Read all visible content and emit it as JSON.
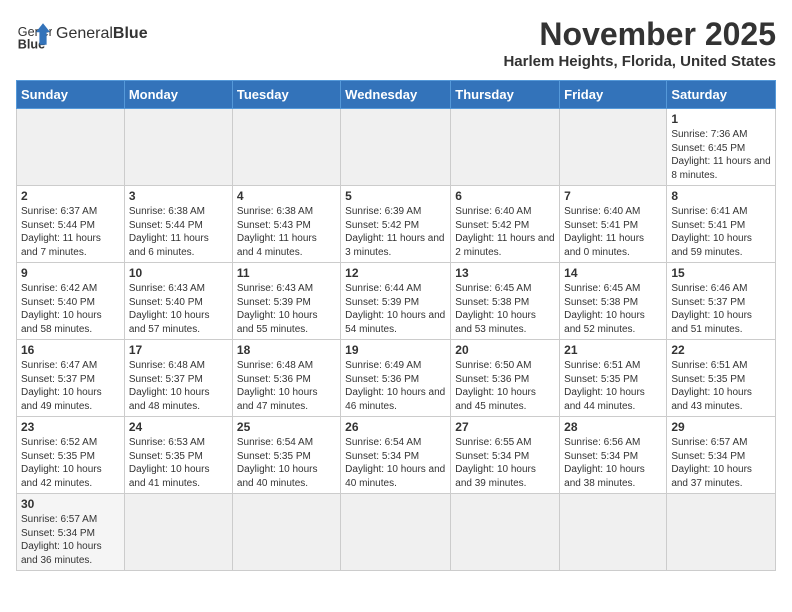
{
  "logo": {
    "text_normal": "General",
    "text_bold": "Blue"
  },
  "title": "November 2025",
  "location": "Harlem Heights, Florida, United States",
  "weekdays": [
    "Sunday",
    "Monday",
    "Tuesday",
    "Wednesday",
    "Thursday",
    "Friday",
    "Saturday"
  ],
  "weeks": [
    [
      {
        "day": "",
        "info": ""
      },
      {
        "day": "",
        "info": ""
      },
      {
        "day": "",
        "info": ""
      },
      {
        "day": "",
        "info": ""
      },
      {
        "day": "",
        "info": ""
      },
      {
        "day": "",
        "info": ""
      },
      {
        "day": "1",
        "info": "Sunrise: 7:36 AM\nSunset: 6:45 PM\nDaylight: 11 hours\nand 8 minutes."
      }
    ],
    [
      {
        "day": "2",
        "info": "Sunrise: 6:37 AM\nSunset: 5:44 PM\nDaylight: 11 hours\nand 7 minutes."
      },
      {
        "day": "3",
        "info": "Sunrise: 6:38 AM\nSunset: 5:44 PM\nDaylight: 11 hours\nand 6 minutes."
      },
      {
        "day": "4",
        "info": "Sunrise: 6:38 AM\nSunset: 5:43 PM\nDaylight: 11 hours\nand 4 minutes."
      },
      {
        "day": "5",
        "info": "Sunrise: 6:39 AM\nSunset: 5:42 PM\nDaylight: 11 hours\nand 3 minutes."
      },
      {
        "day": "6",
        "info": "Sunrise: 6:40 AM\nSunset: 5:42 PM\nDaylight: 11 hours\nand 2 minutes."
      },
      {
        "day": "7",
        "info": "Sunrise: 6:40 AM\nSunset: 5:41 PM\nDaylight: 11 hours\nand 0 minutes."
      },
      {
        "day": "8",
        "info": "Sunrise: 6:41 AM\nSunset: 5:41 PM\nDaylight: 10 hours\nand 59 minutes."
      }
    ],
    [
      {
        "day": "9",
        "info": "Sunrise: 6:42 AM\nSunset: 5:40 PM\nDaylight: 10 hours\nand 58 minutes."
      },
      {
        "day": "10",
        "info": "Sunrise: 6:43 AM\nSunset: 5:40 PM\nDaylight: 10 hours\nand 57 minutes."
      },
      {
        "day": "11",
        "info": "Sunrise: 6:43 AM\nSunset: 5:39 PM\nDaylight: 10 hours\nand 55 minutes."
      },
      {
        "day": "12",
        "info": "Sunrise: 6:44 AM\nSunset: 5:39 PM\nDaylight: 10 hours\nand 54 minutes."
      },
      {
        "day": "13",
        "info": "Sunrise: 6:45 AM\nSunset: 5:38 PM\nDaylight: 10 hours\nand 53 minutes."
      },
      {
        "day": "14",
        "info": "Sunrise: 6:45 AM\nSunset: 5:38 PM\nDaylight: 10 hours\nand 52 minutes."
      },
      {
        "day": "15",
        "info": "Sunrise: 6:46 AM\nSunset: 5:37 PM\nDaylight: 10 hours\nand 51 minutes."
      }
    ],
    [
      {
        "day": "16",
        "info": "Sunrise: 6:47 AM\nSunset: 5:37 PM\nDaylight: 10 hours\nand 49 minutes."
      },
      {
        "day": "17",
        "info": "Sunrise: 6:48 AM\nSunset: 5:37 PM\nDaylight: 10 hours\nand 48 minutes."
      },
      {
        "day": "18",
        "info": "Sunrise: 6:48 AM\nSunset: 5:36 PM\nDaylight: 10 hours\nand 47 minutes."
      },
      {
        "day": "19",
        "info": "Sunrise: 6:49 AM\nSunset: 5:36 PM\nDaylight: 10 hours\nand 46 minutes."
      },
      {
        "day": "20",
        "info": "Sunrise: 6:50 AM\nSunset: 5:36 PM\nDaylight: 10 hours\nand 45 minutes."
      },
      {
        "day": "21",
        "info": "Sunrise: 6:51 AM\nSunset: 5:35 PM\nDaylight: 10 hours\nand 44 minutes."
      },
      {
        "day": "22",
        "info": "Sunrise: 6:51 AM\nSunset: 5:35 PM\nDaylight: 10 hours\nand 43 minutes."
      }
    ],
    [
      {
        "day": "23",
        "info": "Sunrise: 6:52 AM\nSunset: 5:35 PM\nDaylight: 10 hours\nand 42 minutes."
      },
      {
        "day": "24",
        "info": "Sunrise: 6:53 AM\nSunset: 5:35 PM\nDaylight: 10 hours\nand 41 minutes."
      },
      {
        "day": "25",
        "info": "Sunrise: 6:54 AM\nSunset: 5:35 PM\nDaylight: 10 hours\nand 40 minutes."
      },
      {
        "day": "26",
        "info": "Sunrise: 6:54 AM\nSunset: 5:34 PM\nDaylight: 10 hours\nand 40 minutes."
      },
      {
        "day": "27",
        "info": "Sunrise: 6:55 AM\nSunset: 5:34 PM\nDaylight: 10 hours\nand 39 minutes."
      },
      {
        "day": "28",
        "info": "Sunrise: 6:56 AM\nSunset: 5:34 PM\nDaylight: 10 hours\nand 38 minutes."
      },
      {
        "day": "29",
        "info": "Sunrise: 6:57 AM\nSunset: 5:34 PM\nDaylight: 10 hours\nand 37 minutes."
      }
    ],
    [
      {
        "day": "30",
        "info": "Sunrise: 6:57 AM\nSunset: 5:34 PM\nDaylight: 10 hours\nand 36 minutes."
      },
      {
        "day": "",
        "info": ""
      },
      {
        "day": "",
        "info": ""
      },
      {
        "day": "",
        "info": ""
      },
      {
        "day": "",
        "info": ""
      },
      {
        "day": "",
        "info": ""
      },
      {
        "day": "",
        "info": ""
      }
    ]
  ]
}
